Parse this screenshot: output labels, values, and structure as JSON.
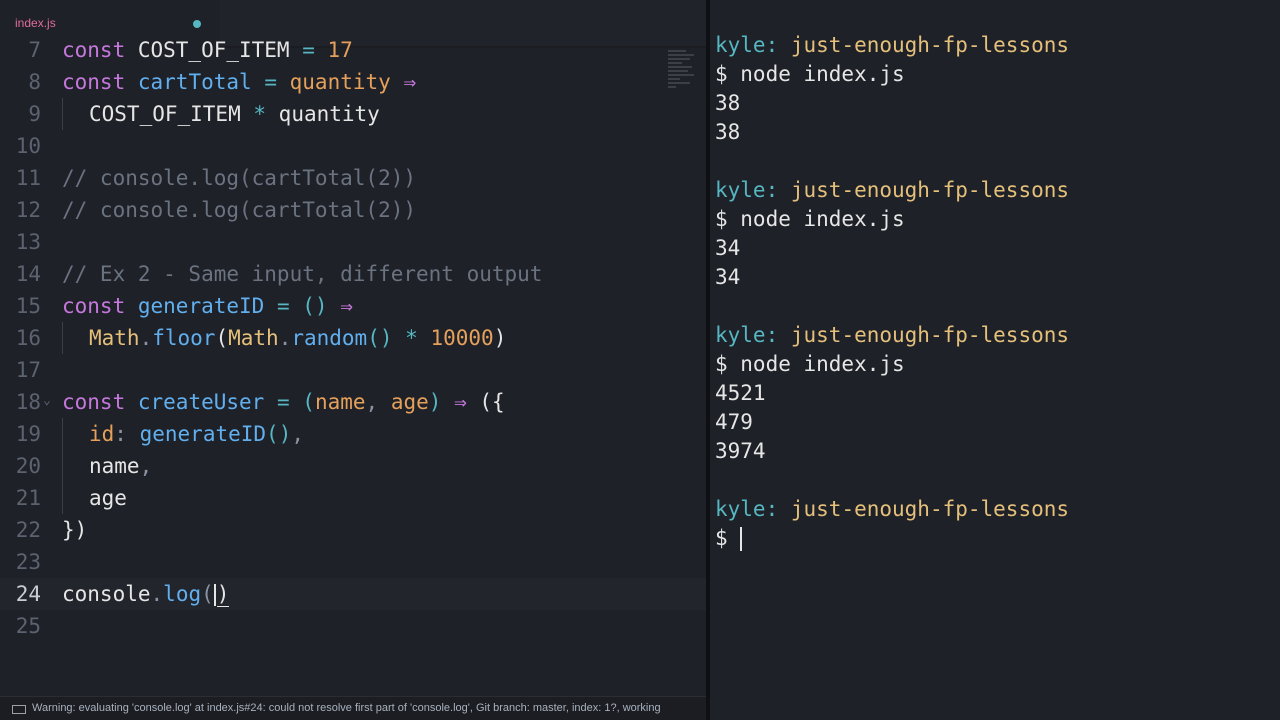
{
  "editor": {
    "tab": {
      "filename": "index.js"
    },
    "lines": [
      {
        "n": "7",
        "tokens": [
          [
            "kw",
            "const"
          ],
          [
            "pl",
            " COST_OF_ITEM "
          ],
          [
            "op",
            "="
          ],
          [
            "num",
            " 17"
          ]
        ]
      },
      {
        "n": "8",
        "tokens": [
          [
            "kw",
            "const"
          ],
          [
            "pl",
            " "
          ],
          [
            "fn",
            "cartTotal"
          ],
          [
            "pl",
            " "
          ],
          [
            "op",
            "="
          ],
          [
            "pl",
            " "
          ],
          [
            "prm",
            "quantity"
          ],
          [
            "pl",
            " "
          ],
          [
            "ar",
            "⇒"
          ]
        ]
      },
      {
        "n": "9",
        "indent": true,
        "tokens": [
          [
            "pl",
            "COST_OF_ITEM "
          ],
          [
            "op",
            "*"
          ],
          [
            "pl",
            " quantity"
          ]
        ]
      },
      {
        "n": "10",
        "tokens": []
      },
      {
        "n": "11",
        "tokens": [
          [
            "cm",
            "// console.log(cartTotal(2))"
          ]
        ]
      },
      {
        "n": "12",
        "tokens": [
          [
            "cm",
            "// console.log(cartTotal(2))"
          ]
        ]
      },
      {
        "n": "13",
        "tokens": []
      },
      {
        "n": "14",
        "tokens": [
          [
            "cm",
            "// Ex 2 - Same input, different output"
          ]
        ]
      },
      {
        "n": "15",
        "tokens": [
          [
            "kw",
            "const"
          ],
          [
            "pl",
            " "
          ],
          [
            "fn",
            "generateID"
          ],
          [
            "pl",
            " "
          ],
          [
            "op",
            "="
          ],
          [
            "pl",
            " "
          ],
          [
            "op",
            "()"
          ],
          [
            "pl",
            " "
          ],
          [
            "ar",
            "⇒"
          ]
        ]
      },
      {
        "n": "16",
        "indent": true,
        "tokens": [
          [
            "cls",
            "Math"
          ],
          [
            "dim",
            "."
          ],
          [
            "fn",
            "floor"
          ],
          [
            "pl",
            "("
          ],
          [
            "cls",
            "Math"
          ],
          [
            "dim",
            "."
          ],
          [
            "fn",
            "random"
          ],
          [
            "op",
            "()"
          ],
          [
            "pl",
            " "
          ],
          [
            "op",
            "*"
          ],
          [
            "pl",
            " "
          ],
          [
            "num",
            "10000"
          ],
          [
            "pl",
            ")"
          ]
        ]
      },
      {
        "n": "17",
        "tokens": []
      },
      {
        "n": "18",
        "fold": true,
        "tokens": [
          [
            "kw",
            "const"
          ],
          [
            "pl",
            " "
          ],
          [
            "fn",
            "createUser"
          ],
          [
            "pl",
            " "
          ],
          [
            "op",
            "="
          ],
          [
            "pl",
            " "
          ],
          [
            "op",
            "("
          ],
          [
            "prm",
            "name"
          ],
          [
            "dim",
            ","
          ],
          [
            "pl",
            " "
          ],
          [
            "prm",
            "age"
          ],
          [
            "op",
            ")"
          ],
          [
            "pl",
            " "
          ],
          [
            "ar",
            "⇒"
          ],
          [
            "pl",
            " ({"
          ]
        ]
      },
      {
        "n": "19",
        "indent": true,
        "tokens": [
          [
            "prm",
            "id"
          ],
          [
            "dim",
            ":"
          ],
          [
            "pl",
            " "
          ],
          [
            "fn",
            "generateID"
          ],
          [
            "op",
            "()"
          ],
          [
            "dim",
            ","
          ]
        ]
      },
      {
        "n": "20",
        "indent": true,
        "tokens": [
          [
            "pl",
            "name"
          ],
          [
            "dim",
            ","
          ]
        ]
      },
      {
        "n": "21",
        "indent": true,
        "tokens": [
          [
            "pl",
            "age"
          ]
        ]
      },
      {
        "n": "22",
        "tokens": [
          [
            "pl",
            "})"
          ]
        ]
      },
      {
        "n": "23",
        "tokens": []
      },
      {
        "n": "24",
        "active": true,
        "tokens": [
          [
            "pl",
            "console"
          ],
          [
            "dim",
            "."
          ],
          [
            "fn",
            "log"
          ],
          [
            "dim",
            "("
          ],
          [
            "caret",
            ""
          ],
          [
            "cur",
            ")"
          ]
        ]
      },
      {
        "n": "25",
        "tokens": []
      }
    ]
  },
  "status": {
    "message": "Warning: evaluating 'console.log' at index.js#24: could not resolve first part of 'console.log', Git branch: master, index: 1?, working"
  },
  "terminal": {
    "blocks": [
      {
        "user": "kyle:",
        "dir": "just-enough-fp-lessons",
        "command": "$ node index.js",
        "output": [
          "38",
          "38"
        ]
      },
      {
        "user": "kyle:",
        "dir": "just-enough-fp-lessons",
        "command": "$ node index.js",
        "output": [
          "34",
          "34"
        ]
      },
      {
        "user": "kyle:",
        "dir": "just-enough-fp-lessons",
        "command": "$ node index.js",
        "output": [
          "4521",
          "479",
          "3974"
        ]
      },
      {
        "user": "kyle:",
        "dir": "just-enough-fp-lessons",
        "command": "$",
        "output": [],
        "active": true
      }
    ]
  }
}
